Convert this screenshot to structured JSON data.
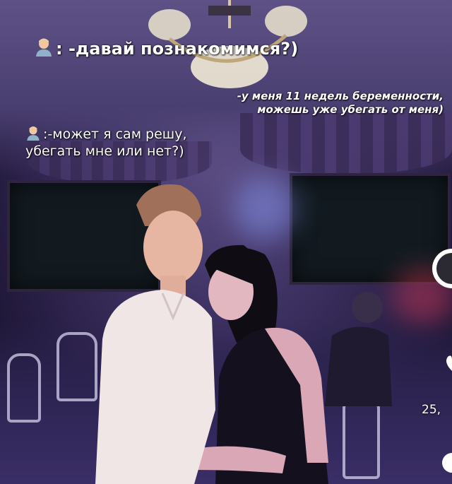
{
  "captions": {
    "line1": ": -давай познакомимся?)",
    "line2": "-у меня 11 недель беременности, можешь уже убегать от меня)",
    "line3": ":-может я сам решу, убегать мне или нет?)"
  },
  "side_ui": {
    "like_count": "25,"
  },
  "icons": {
    "speaker_emoji": "man-emoji",
    "side_avatar": "avatar-icon",
    "side_like": "heart-icon"
  }
}
